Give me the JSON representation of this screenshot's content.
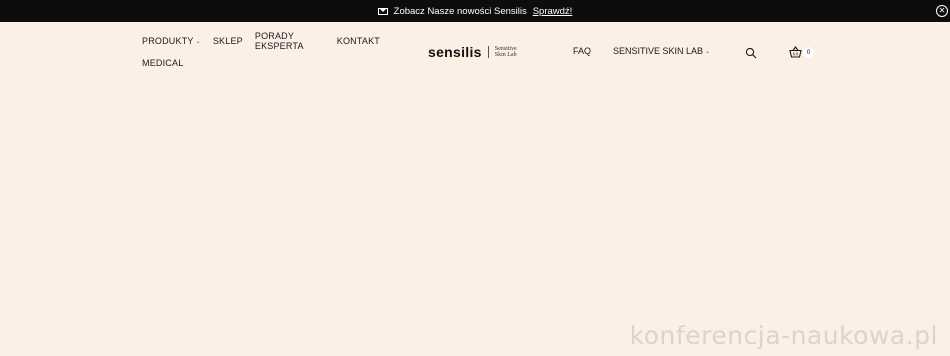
{
  "promo": {
    "text": "Zobacz Nasze nowości Sensilis",
    "link": "Sprawdź!",
    "close_icon": "close-circle-icon",
    "icon": "envelope-icon"
  },
  "nav_left": {
    "row1": [
      "PRODUKTY",
      "SKLEP",
      "PORADY EKSPERTA",
      "KONTAKT"
    ],
    "row2": [
      "MEDICAL"
    ]
  },
  "logo": {
    "word": "sensilis",
    "sub1": "Sensitive",
    "sub2": "Skin Lab"
  },
  "nav_right": [
    "FAQ",
    "SENSITIVE SKIN LAB"
  ],
  "cart": {
    "count": "0",
    "icon": "basket-icon"
  },
  "search": {
    "icon": "search-icon"
  },
  "watermark": "konferencja-naukowa.pl",
  "colors": {
    "promo_bg": "#0d0d0d",
    "page_bg": "#fcefe6",
    "text": "#1a1a1a"
  }
}
